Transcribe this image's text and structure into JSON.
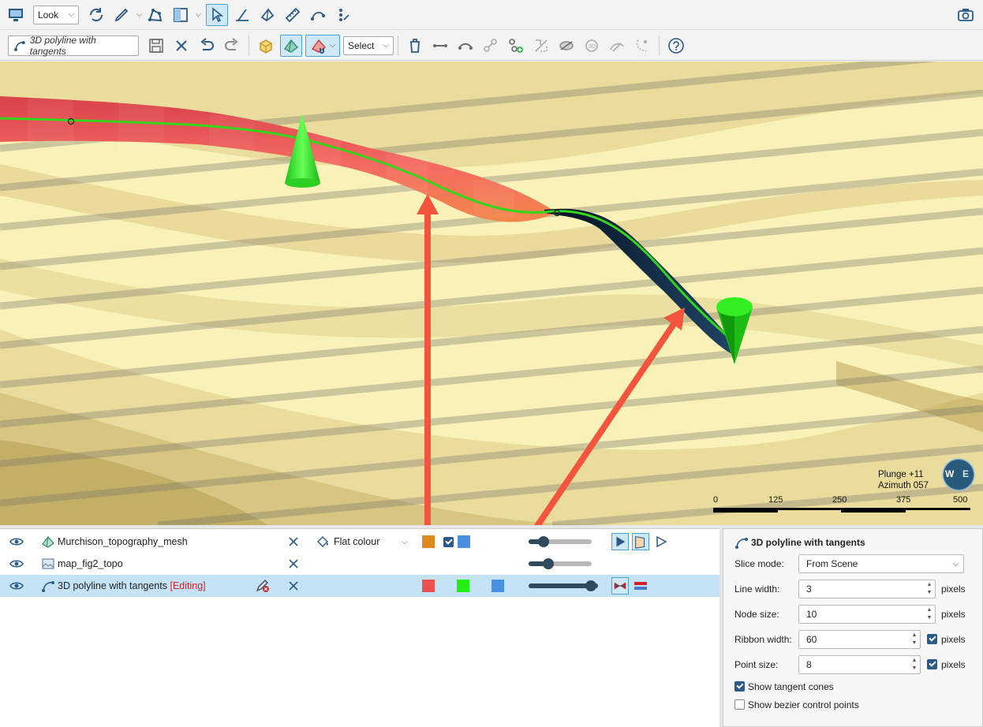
{
  "toolbar1": {
    "view_mode": "Look"
  },
  "toolbar2": {
    "object_tag": "3D polyline with tangents",
    "select_mode": "Select"
  },
  "viewport": {
    "plunge_label": "Plunge +11",
    "azimuth_label": "Azimuth 057",
    "compass_letters": [
      "W",
      "E"
    ],
    "scale_ticks": [
      "0",
      "125",
      "250",
      "375",
      "500"
    ],
    "colors": {
      "terrain": "#f7f0b4",
      "ribbon_red": "#f05d5d",
      "ribbon_orange": "#f2874a",
      "ribbon_dark": "#15304f",
      "line_green": "#33d61a",
      "cone_green": "#33ee22",
      "arrow": "#f2553c"
    }
  },
  "objects": [
    {
      "name": "Murchison_topography_mesh",
      "icon": "mesh-icon",
      "colour_mode": "Flat colour",
      "swatch_colors": [
        "#e08a1e",
        "#4a90e2"
      ],
      "checkbox_checked": true
    },
    {
      "name": "map_fig2_topo",
      "icon": "image-icon"
    },
    {
      "name": "3D polyline with tangents",
      "editing_label": "[Editing]",
      "icon": "polyline-icon",
      "swatch_colors": [
        "#f05050",
        "#22ee11",
        "#4a90e2"
      ]
    }
  ],
  "properties": {
    "title": "3D polyline with tangents",
    "slice_mode_label": "Slice mode:",
    "slice_mode_value": "From Scene",
    "line_width_label": "Line width:",
    "line_width_value": "3",
    "node_size_label": "Node size:",
    "node_size_value": "10",
    "ribbon_width_label": "Ribbon width:",
    "ribbon_width_value": "60",
    "point_size_label": "Point size:",
    "point_size_value": "8",
    "units": "pixels",
    "show_tangent_cones_label": "Show tangent cones",
    "show_tangent_cones": true,
    "show_bezier_label": "Show bezier control points",
    "show_bezier": false
  }
}
